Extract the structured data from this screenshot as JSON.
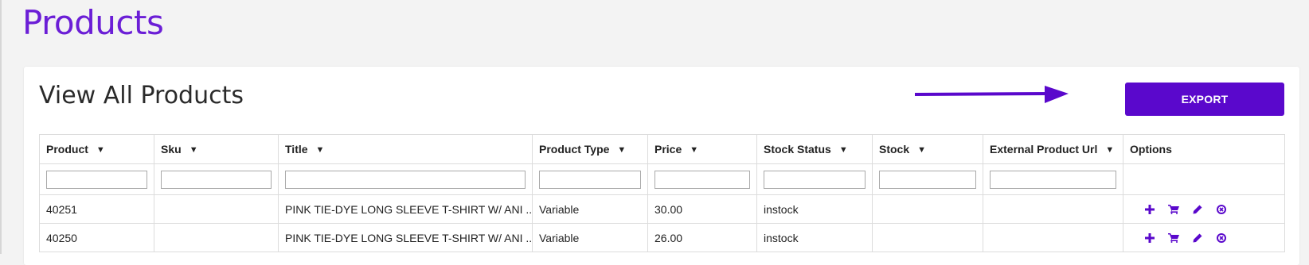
{
  "page": {
    "title": "Products"
  },
  "card": {
    "title": "View All Products",
    "export_label": "EXPORT"
  },
  "colors": {
    "brand": "#6b1ed6",
    "button": "#5a08cc",
    "arrow": "#5a08cc"
  },
  "table": {
    "columns": [
      {
        "label": "Product",
        "sortable": true
      },
      {
        "label": "Sku",
        "sortable": true
      },
      {
        "label": "Title",
        "sortable": true
      },
      {
        "label": "Product Type",
        "sortable": true
      },
      {
        "label": "Price",
        "sortable": true
      },
      {
        "label": "Stock Status",
        "sortable": true
      },
      {
        "label": "Stock",
        "sortable": true
      },
      {
        "label": "External Product Url",
        "sortable": true
      },
      {
        "label": "Options",
        "sortable": false
      }
    ],
    "rows": [
      {
        "product": "40251",
        "sku": "",
        "title": "PINK TIE-DYE LONG SLEEVE T-SHIRT W/ ANI ...",
        "type": "Variable",
        "price": "30.00",
        "stock_status": "instock",
        "stock": "",
        "url": ""
      },
      {
        "product": "40250",
        "sku": "",
        "title": "PINK TIE-DYE LONG SLEEVE T-SHIRT W/ ANI ...",
        "type": "Variable",
        "price": "26.00",
        "stock_status": "instock",
        "stock": "",
        "url": ""
      }
    ],
    "row_option_icons": [
      "plus-icon",
      "cart-icon",
      "pencil-icon",
      "cancel-circle-icon"
    ]
  }
}
